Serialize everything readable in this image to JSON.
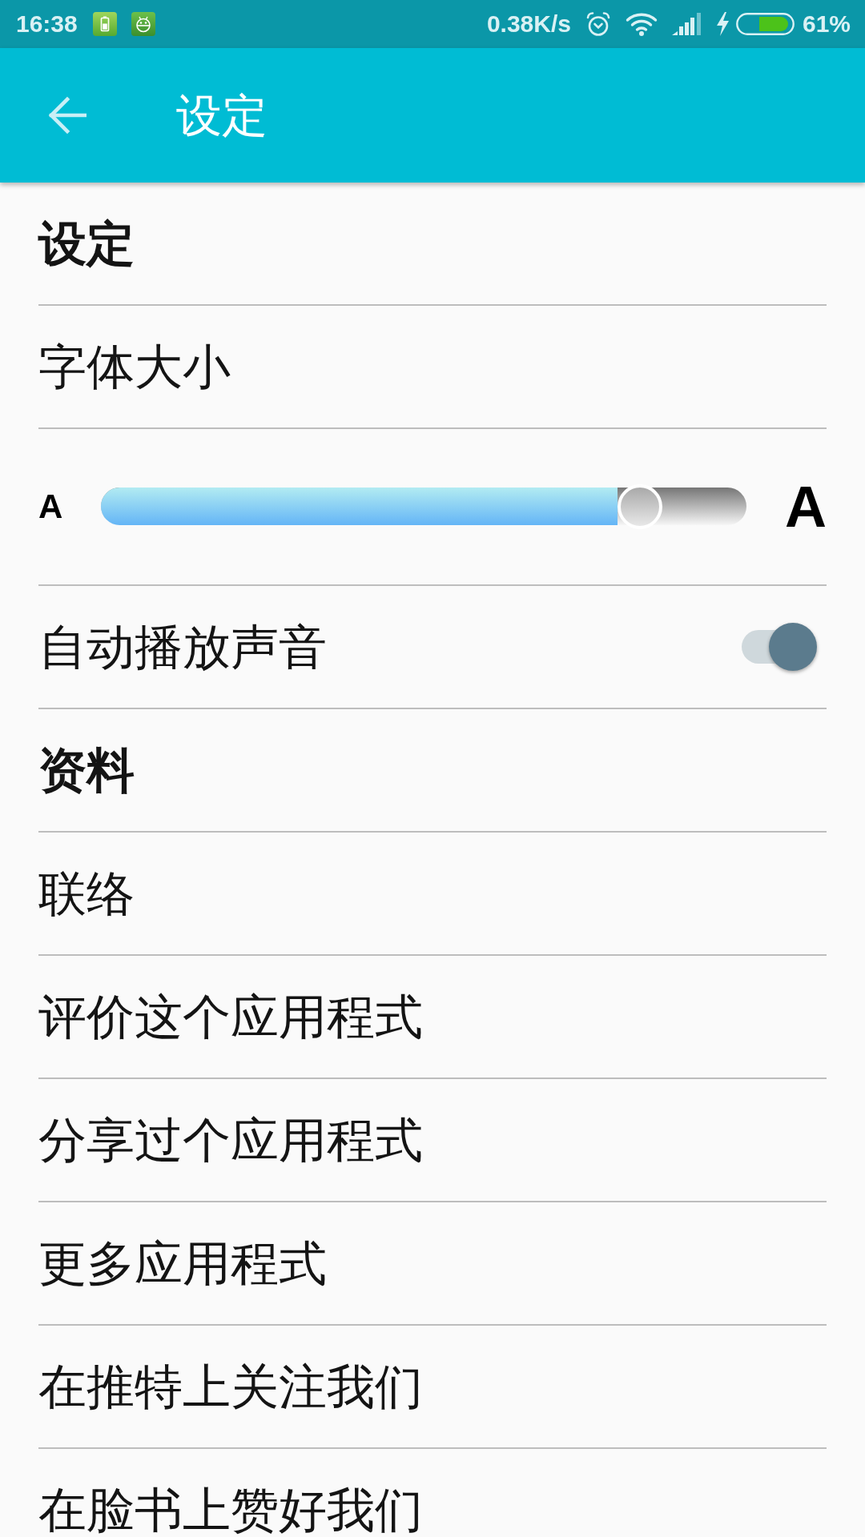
{
  "status_bar": {
    "time": "16:38",
    "network_speed": "0.38K/s",
    "battery_percent": "61%"
  },
  "app_bar": {
    "title": "设定"
  },
  "settings_list": [
    {
      "kind": "header",
      "label": "设定"
    },
    {
      "kind": "item",
      "label": "字体大小"
    },
    {
      "kind": "slider",
      "min_label": "A",
      "max_label": "A",
      "level": 0.8
    },
    {
      "kind": "switch",
      "label": "自动播放声音",
      "on": true
    },
    {
      "kind": "header",
      "label": "资料"
    },
    {
      "kind": "item",
      "label": "联络"
    },
    {
      "kind": "item",
      "label": "评价这个应用程式"
    },
    {
      "kind": "item",
      "label": "分享过个应用程式"
    },
    {
      "kind": "item",
      "label": "更多应用程式"
    },
    {
      "kind": "item",
      "label": "在推特上关注我们"
    },
    {
      "kind": "item",
      "label": "在脸书上赞好我们"
    }
  ]
}
